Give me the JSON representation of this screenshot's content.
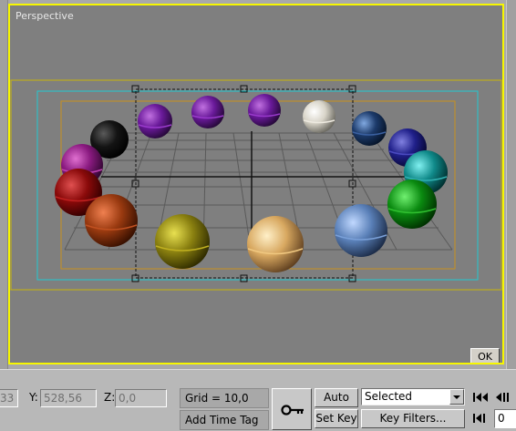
{
  "viewport": {
    "label": "Perspective",
    "ok_label": "OK"
  },
  "coords": {
    "x_value": "33",
    "y_label": "Y:",
    "y_value": "528,56",
    "z_label": "Z:",
    "z_value": "0,0"
  },
  "grid": {
    "label": "Grid = 10,0"
  },
  "time_tag": {
    "label": "Add Time Tag"
  },
  "keys": {
    "auto_key": "Auto Key",
    "set_key": "Set Key",
    "selected": "Selected",
    "key_filters": "Key Filters...",
    "frame": "0"
  },
  "icons": [
    "key-icon",
    "go-to-start-icon",
    "previous-frame-icon",
    "chevron-down-icon"
  ],
  "colors": {
    "viewport_border": "#f7f700",
    "grid": "#5a5a5a",
    "safe_frame_cyan": "#20c8d0",
    "safe_frame_orange": "#c8901e"
  }
}
